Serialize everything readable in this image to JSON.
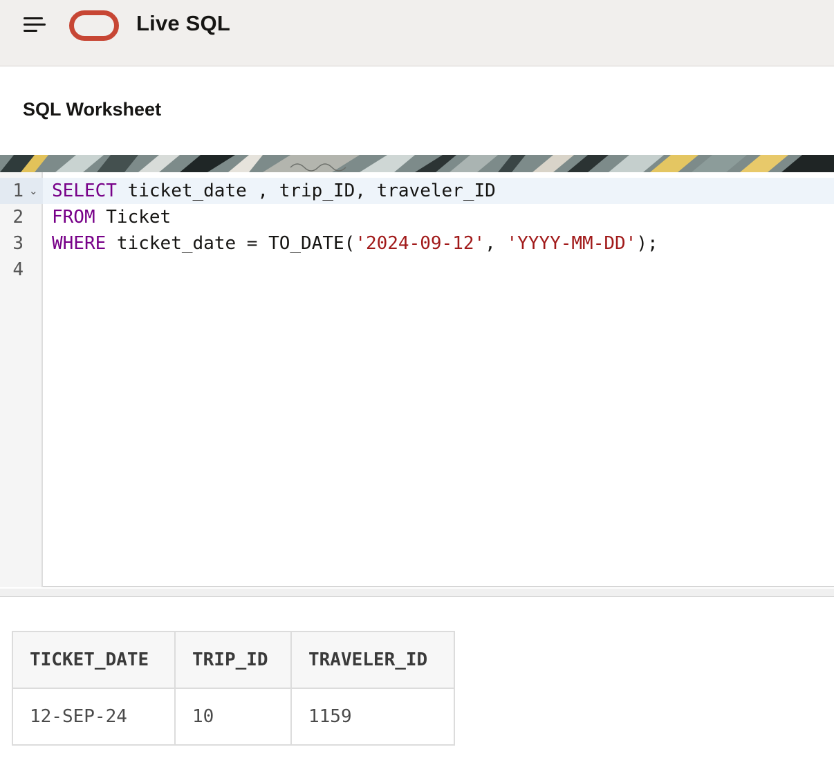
{
  "header": {
    "app_title": "Live SQL"
  },
  "page": {
    "title": "SQL Worksheet"
  },
  "editor": {
    "line_numbers": [
      "1",
      "2",
      "3",
      "4"
    ],
    "lines": {
      "l1": {
        "kw": "SELECT",
        "rest": " ticket_date , trip_ID, traveler_ID"
      },
      "l2": {
        "kw": "FROM",
        "rest": " Ticket"
      },
      "l3": {
        "kw": "WHERE",
        "mid": " ticket_date = TO_DATE(",
        "str1": "'2024-09-12'",
        "sep": ", ",
        "str2": "'YYYY-MM-DD'",
        "end": ");"
      }
    }
  },
  "results": {
    "columns": [
      "TICKET_DATE",
      "TRIP_ID",
      "TRAVELER_ID"
    ],
    "rows": [
      [
        "12-SEP-24",
        "10",
        "1159"
      ]
    ]
  },
  "colors": {
    "brand": "#c74634",
    "keyword": "#770088",
    "string": "#a11a1a"
  }
}
